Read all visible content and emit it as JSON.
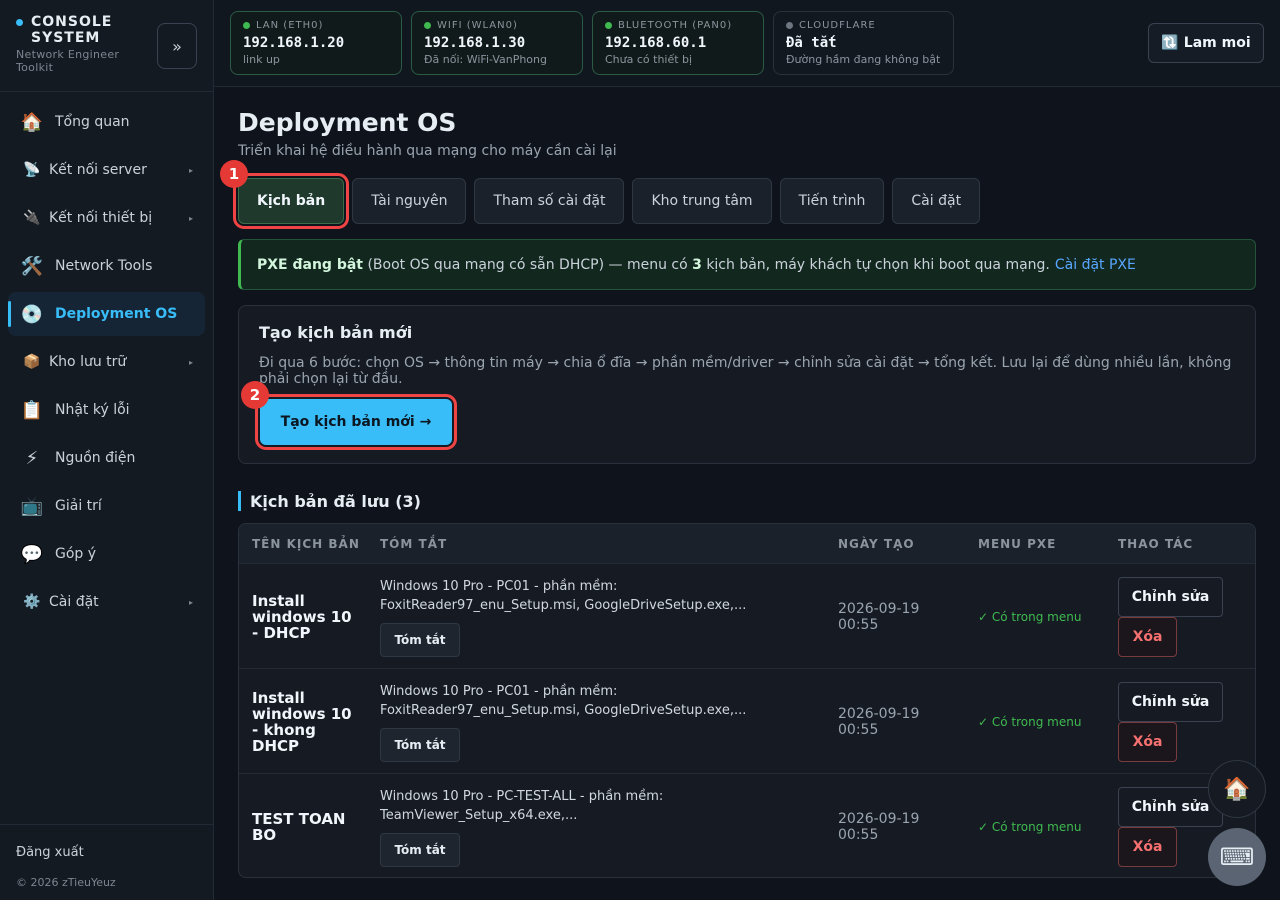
{
  "brand": {
    "title": "CONSOLE SYSTEM",
    "subtitle": "Network Engineer Toolkit",
    "collapse_label": "»"
  },
  "sidebar": {
    "items": [
      {
        "label": "Tổng quan",
        "icon": "🏠"
      },
      {
        "label": "Kết nối server",
        "icon": "📡"
      },
      {
        "label": "Kết nối thiết bị",
        "icon": "🔌"
      },
      {
        "label": "Network Tools",
        "icon": "🛠️"
      },
      {
        "label": "Deployment OS",
        "icon": "💿"
      },
      {
        "label": "Kho lưu trữ",
        "icon": "📦"
      },
      {
        "label": "Nhật ký lỗi",
        "icon": "📋"
      },
      {
        "label": "Nguồn điện",
        "icon": "⚡"
      },
      {
        "label": "Giải trí",
        "icon": "📺"
      },
      {
        "label": "Góp ý",
        "icon": "💬"
      },
      {
        "label": "Cài đặt",
        "icon": "⚙️"
      }
    ],
    "arrow": "▸",
    "logout": "Đăng xuất",
    "copyright": "© 2026 zTieuYeuz"
  },
  "topbar": {
    "interfaces": [
      {
        "label": "LAN (ETH0)",
        "ip": "192.168.1.20",
        "status": "link up",
        "state": "up"
      },
      {
        "label": "WIFI (WLAN0)",
        "ip": "192.168.1.30",
        "status": "Đã nối: WiFi-VanPhong",
        "state": "up"
      },
      {
        "label": "BLUETOOTH (PAN0)",
        "ip": "192.168.60.1",
        "status": "Chưa có thiết bị",
        "state": "up"
      },
      {
        "label": "CLOUDFLARE",
        "ip": "Đã tắt",
        "status": "Đường hầm đang không bật",
        "state": "off"
      }
    ],
    "refresh_icon": "🔃",
    "refresh_label": "Lam moi"
  },
  "page": {
    "title": "Deployment OS",
    "subtitle": "Triển khai hệ điều hành qua mạng cho máy cần cài lại"
  },
  "tabs": [
    "Kịch bản",
    "Tài nguyên",
    "Tham số cài đặt",
    "Kho trung tâm",
    "Tiến trình",
    "Cài đặt"
  ],
  "badges": [
    "1",
    "2"
  ],
  "pxe_alert": {
    "bold": "PXE đang bật",
    "text1": "(Boot OS qua mạng có sẵn DHCP) — menu có",
    "count": "3",
    "text2": "kịch bản, máy khách tự chọn khi boot qua mạng.",
    "link": "Cài đặt PXE"
  },
  "create": {
    "title": "Tạo kịch bản mới",
    "description": "Đi qua 6 bước: chọn OS → thông tin máy → chia ổ đĩa → phần mềm/driver → chỉnh sửa cài đặt → tổng kết. Lưu lại để dùng nhiều lần, không phải chọn lại từ đầu.",
    "button": "Tạo kịch bản mới →"
  },
  "saved": {
    "heading": "Kịch bản đã lưu (3)",
    "columns": [
      "TÊN KỊCH BẢN",
      "TÓM TẮT",
      "NGÀY TẠO",
      "MENU PXE",
      "THAO TÁC"
    ],
    "rows": [
      {
        "name": "Install windows 10 - DHCP",
        "summary": "Windows 10 Pro - PC01 - phần mềm: FoxitReader97_enu_Setup.msi, GoogleDriveSetup.exe,...",
        "summary_btn": "Tóm tắt",
        "date": "2026-09-19 00:55",
        "menu": "✓ Có trong menu",
        "edit": "Chỉnh sửa",
        "delete": "Xóa"
      },
      {
        "name": "Install windows 10 - khong DHCP",
        "summary": "Windows 10 Pro - PC01 - phần mềm: FoxitReader97_enu_Setup.msi, GoogleDriveSetup.exe,...",
        "summary_btn": "Tóm tắt",
        "date": "2026-09-19 00:55",
        "menu": "✓ Có trong menu",
        "edit": "Chỉnh sửa",
        "delete": "Xóa"
      },
      {
        "name": "TEST TOAN BO",
        "summary": "Windows 10 Pro - PC-TEST-ALL - phần mềm: TeamViewer_Setup_x64.exe,...",
        "summary_btn": "Tóm tắt",
        "date": "2026-09-19 00:55",
        "menu": "✓ Có trong menu",
        "edit": "Chỉnh sửa",
        "delete": "Xóa"
      }
    ]
  },
  "fabs": {
    "home_icon": "🏠",
    "keyboard_icon": "⌨"
  },
  "colors": {
    "accent": "#38bdf8",
    "success": "#3fb950",
    "danger": "#f87171",
    "highlight": "#ef4444"
  }
}
